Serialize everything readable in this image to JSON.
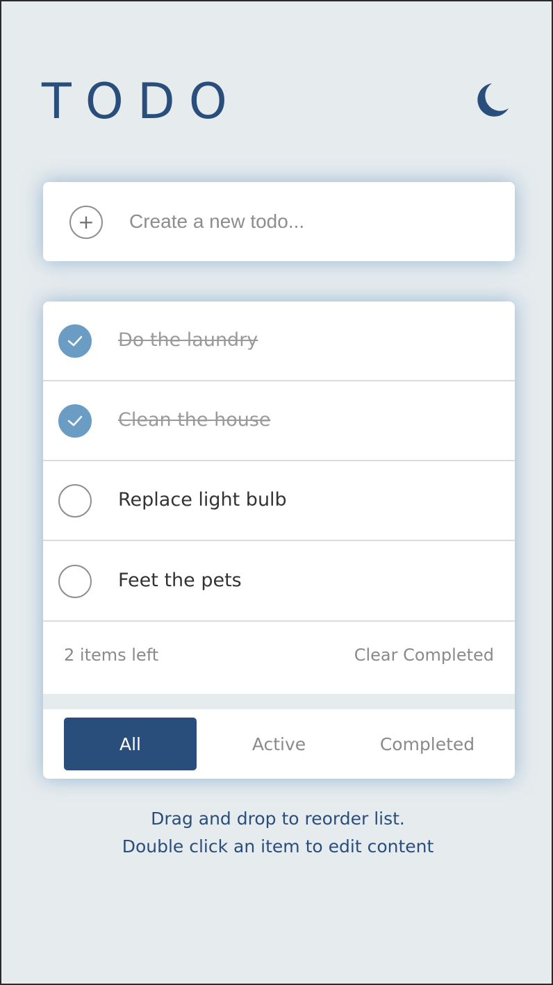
{
  "header": {
    "title": "TODO",
    "theme_toggle_icon": "moon-icon"
  },
  "new_todo": {
    "add_icon": "plus-icon",
    "add_symbol": "+",
    "placeholder": "Create a new todo...",
    "value": ""
  },
  "todos": [
    {
      "text": "Do the laundry",
      "completed": true
    },
    {
      "text": "Clean the house",
      "completed": true
    },
    {
      "text": "Replace light bulb",
      "completed": false
    },
    {
      "text": "Feet the pets",
      "completed": false
    }
  ],
  "footer": {
    "items_left": "2 items left",
    "clear_label": "Clear Completed"
  },
  "filters": {
    "all": "All",
    "active": "Active",
    "completed": "Completed",
    "selected": "All"
  },
  "hints": {
    "line1": "Drag and drop to reorder list.",
    "line2": "Double click an item to edit content"
  },
  "colors": {
    "background": "#e6ebee",
    "accent": "#2a4e7c",
    "check_done": "#6a9cc4"
  }
}
